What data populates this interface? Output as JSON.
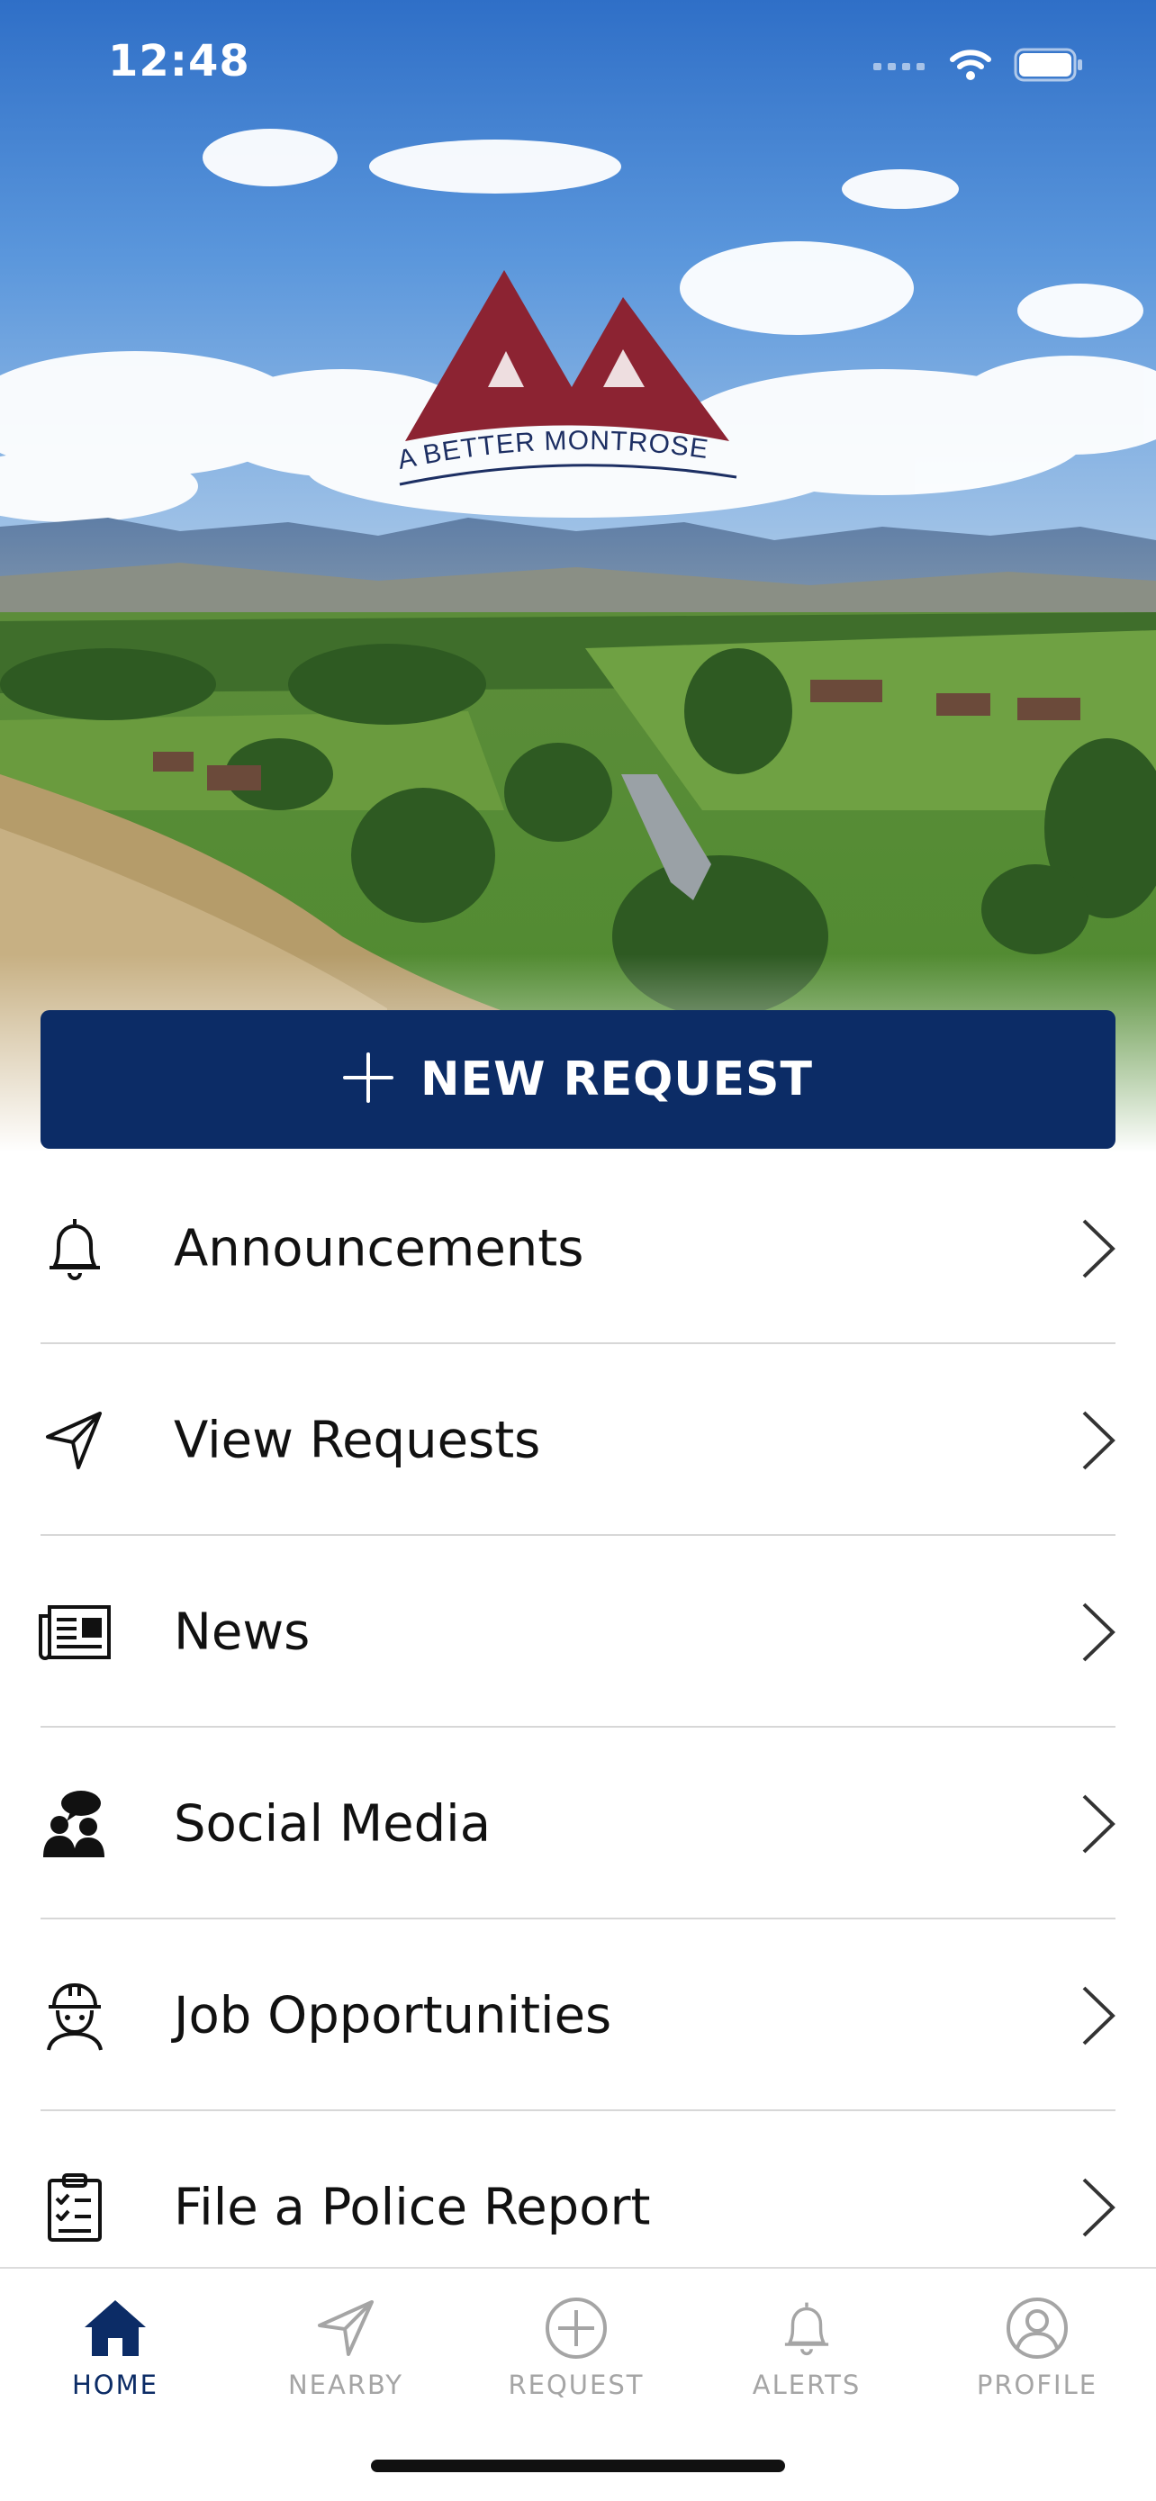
{
  "status_bar": {
    "time": "12:48"
  },
  "logo": {
    "text": "A BETTER MONTROSE",
    "mark_color": "#8c2332",
    "text_color": "#1d2f63"
  },
  "primary_action": {
    "label": "NEW REQUEST",
    "color": "#0c2c66"
  },
  "menu": {
    "items": [
      {
        "label": "Announcements",
        "icon": "bell-icon"
      },
      {
        "label": "View Requests",
        "icon": "send-arrow-icon"
      },
      {
        "label": "News",
        "icon": "newspaper-icon"
      },
      {
        "label": "Social Media",
        "icon": "people-chat-icon"
      },
      {
        "label": "Job Opportunities",
        "icon": "hardhat-worker-icon"
      },
      {
        "label": "File a Police Report",
        "icon": "clipboard-checklist-icon"
      }
    ]
  },
  "tab_bar": {
    "active_color": "#0c2c66",
    "inactive_color": "#a5a5a5",
    "tabs": [
      {
        "label": "HOME",
        "icon": "home-icon",
        "active": true
      },
      {
        "label": "NEARBY",
        "icon": "location-arrow-icon",
        "active": false
      },
      {
        "label": "REQUEST",
        "icon": "plus-circle-icon",
        "active": false
      },
      {
        "label": "ALERTS",
        "icon": "bell-icon",
        "active": false
      },
      {
        "label": "PROFILE",
        "icon": "user-circle-icon",
        "active": false
      }
    ]
  }
}
